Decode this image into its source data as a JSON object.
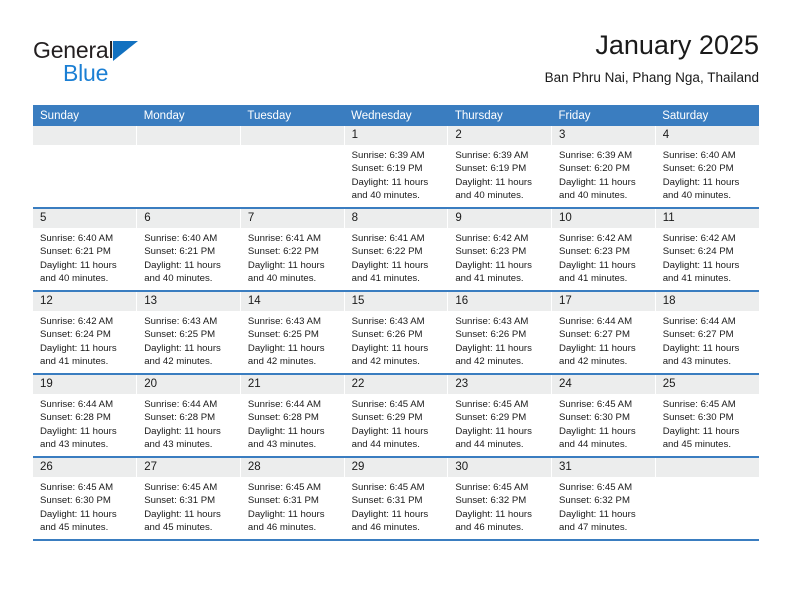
{
  "brand": {
    "name_part1": "General",
    "name_part2": "Blue",
    "triangle_icon": "triangle-icon",
    "accent_color": "#1b7fd4"
  },
  "header": {
    "title": "January 2025",
    "subtitle": "Ban Phru Nai, Phang Nga, Thailand"
  },
  "theme": {
    "header_row_bg": "#3a7dc0",
    "daynum_bg": "#eceded",
    "week_divider": "#3a7dc0"
  },
  "weekdays": [
    "Sunday",
    "Monday",
    "Tuesday",
    "Wednesday",
    "Thursday",
    "Friday",
    "Saturday"
  ],
  "weeks": [
    [
      {
        "day": "",
        "sunrise": "",
        "sunset": "",
        "daylight1": "",
        "daylight2": "",
        "empty": true
      },
      {
        "day": "",
        "sunrise": "",
        "sunset": "",
        "daylight1": "",
        "daylight2": "",
        "empty": true
      },
      {
        "day": "",
        "sunrise": "",
        "sunset": "",
        "daylight1": "",
        "daylight2": "",
        "empty": true
      },
      {
        "day": "1",
        "sunrise": "Sunrise: 6:39 AM",
        "sunset": "Sunset: 6:19 PM",
        "daylight1": "Daylight: 11 hours",
        "daylight2": "and 40 minutes.",
        "empty": false
      },
      {
        "day": "2",
        "sunrise": "Sunrise: 6:39 AM",
        "sunset": "Sunset: 6:19 PM",
        "daylight1": "Daylight: 11 hours",
        "daylight2": "and 40 minutes.",
        "empty": false
      },
      {
        "day": "3",
        "sunrise": "Sunrise: 6:39 AM",
        "sunset": "Sunset: 6:20 PM",
        "daylight1": "Daylight: 11 hours",
        "daylight2": "and 40 minutes.",
        "empty": false
      },
      {
        "day": "4",
        "sunrise": "Sunrise: 6:40 AM",
        "sunset": "Sunset: 6:20 PM",
        "daylight1": "Daylight: 11 hours",
        "daylight2": "and 40 minutes.",
        "empty": false
      }
    ],
    [
      {
        "day": "5",
        "sunrise": "Sunrise: 6:40 AM",
        "sunset": "Sunset: 6:21 PM",
        "daylight1": "Daylight: 11 hours",
        "daylight2": "and 40 minutes.",
        "empty": false
      },
      {
        "day": "6",
        "sunrise": "Sunrise: 6:40 AM",
        "sunset": "Sunset: 6:21 PM",
        "daylight1": "Daylight: 11 hours",
        "daylight2": "and 40 minutes.",
        "empty": false
      },
      {
        "day": "7",
        "sunrise": "Sunrise: 6:41 AM",
        "sunset": "Sunset: 6:22 PM",
        "daylight1": "Daylight: 11 hours",
        "daylight2": "and 40 minutes.",
        "empty": false
      },
      {
        "day": "8",
        "sunrise": "Sunrise: 6:41 AM",
        "sunset": "Sunset: 6:22 PM",
        "daylight1": "Daylight: 11 hours",
        "daylight2": "and 41 minutes.",
        "empty": false
      },
      {
        "day": "9",
        "sunrise": "Sunrise: 6:42 AM",
        "sunset": "Sunset: 6:23 PM",
        "daylight1": "Daylight: 11 hours",
        "daylight2": "and 41 minutes.",
        "empty": false
      },
      {
        "day": "10",
        "sunrise": "Sunrise: 6:42 AM",
        "sunset": "Sunset: 6:23 PM",
        "daylight1": "Daylight: 11 hours",
        "daylight2": "and 41 minutes.",
        "empty": false
      },
      {
        "day": "11",
        "sunrise": "Sunrise: 6:42 AM",
        "sunset": "Sunset: 6:24 PM",
        "daylight1": "Daylight: 11 hours",
        "daylight2": "and 41 minutes.",
        "empty": false
      }
    ],
    [
      {
        "day": "12",
        "sunrise": "Sunrise: 6:42 AM",
        "sunset": "Sunset: 6:24 PM",
        "daylight1": "Daylight: 11 hours",
        "daylight2": "and 41 minutes.",
        "empty": false
      },
      {
        "day": "13",
        "sunrise": "Sunrise: 6:43 AM",
        "sunset": "Sunset: 6:25 PM",
        "daylight1": "Daylight: 11 hours",
        "daylight2": "and 42 minutes.",
        "empty": false
      },
      {
        "day": "14",
        "sunrise": "Sunrise: 6:43 AM",
        "sunset": "Sunset: 6:25 PM",
        "daylight1": "Daylight: 11 hours",
        "daylight2": "and 42 minutes.",
        "empty": false
      },
      {
        "day": "15",
        "sunrise": "Sunrise: 6:43 AM",
        "sunset": "Sunset: 6:26 PM",
        "daylight1": "Daylight: 11 hours",
        "daylight2": "and 42 minutes.",
        "empty": false
      },
      {
        "day": "16",
        "sunrise": "Sunrise: 6:43 AM",
        "sunset": "Sunset: 6:26 PM",
        "daylight1": "Daylight: 11 hours",
        "daylight2": "and 42 minutes.",
        "empty": false
      },
      {
        "day": "17",
        "sunrise": "Sunrise: 6:44 AM",
        "sunset": "Sunset: 6:27 PM",
        "daylight1": "Daylight: 11 hours",
        "daylight2": "and 42 minutes.",
        "empty": false
      },
      {
        "day": "18",
        "sunrise": "Sunrise: 6:44 AM",
        "sunset": "Sunset: 6:27 PM",
        "daylight1": "Daylight: 11 hours",
        "daylight2": "and 43 minutes.",
        "empty": false
      }
    ],
    [
      {
        "day": "19",
        "sunrise": "Sunrise: 6:44 AM",
        "sunset": "Sunset: 6:28 PM",
        "daylight1": "Daylight: 11 hours",
        "daylight2": "and 43 minutes.",
        "empty": false
      },
      {
        "day": "20",
        "sunrise": "Sunrise: 6:44 AM",
        "sunset": "Sunset: 6:28 PM",
        "daylight1": "Daylight: 11 hours",
        "daylight2": "and 43 minutes.",
        "empty": false
      },
      {
        "day": "21",
        "sunrise": "Sunrise: 6:44 AM",
        "sunset": "Sunset: 6:28 PM",
        "daylight1": "Daylight: 11 hours",
        "daylight2": "and 43 minutes.",
        "empty": false
      },
      {
        "day": "22",
        "sunrise": "Sunrise: 6:45 AM",
        "sunset": "Sunset: 6:29 PM",
        "daylight1": "Daylight: 11 hours",
        "daylight2": "and 44 minutes.",
        "empty": false
      },
      {
        "day": "23",
        "sunrise": "Sunrise: 6:45 AM",
        "sunset": "Sunset: 6:29 PM",
        "daylight1": "Daylight: 11 hours",
        "daylight2": "and 44 minutes.",
        "empty": false
      },
      {
        "day": "24",
        "sunrise": "Sunrise: 6:45 AM",
        "sunset": "Sunset: 6:30 PM",
        "daylight1": "Daylight: 11 hours",
        "daylight2": "and 44 minutes.",
        "empty": false
      },
      {
        "day": "25",
        "sunrise": "Sunrise: 6:45 AM",
        "sunset": "Sunset: 6:30 PM",
        "daylight1": "Daylight: 11 hours",
        "daylight2": "and 45 minutes.",
        "empty": false
      }
    ],
    [
      {
        "day": "26",
        "sunrise": "Sunrise: 6:45 AM",
        "sunset": "Sunset: 6:30 PM",
        "daylight1": "Daylight: 11 hours",
        "daylight2": "and 45 minutes.",
        "empty": false
      },
      {
        "day": "27",
        "sunrise": "Sunrise: 6:45 AM",
        "sunset": "Sunset: 6:31 PM",
        "daylight1": "Daylight: 11 hours",
        "daylight2": "and 45 minutes.",
        "empty": false
      },
      {
        "day": "28",
        "sunrise": "Sunrise: 6:45 AM",
        "sunset": "Sunset: 6:31 PM",
        "daylight1": "Daylight: 11 hours",
        "daylight2": "and 46 minutes.",
        "empty": false
      },
      {
        "day": "29",
        "sunrise": "Sunrise: 6:45 AM",
        "sunset": "Sunset: 6:31 PM",
        "daylight1": "Daylight: 11 hours",
        "daylight2": "and 46 minutes.",
        "empty": false
      },
      {
        "day": "30",
        "sunrise": "Sunrise: 6:45 AM",
        "sunset": "Sunset: 6:32 PM",
        "daylight1": "Daylight: 11 hours",
        "daylight2": "and 46 minutes.",
        "empty": false
      },
      {
        "day": "31",
        "sunrise": "Sunrise: 6:45 AM",
        "sunset": "Sunset: 6:32 PM",
        "daylight1": "Daylight: 11 hours",
        "daylight2": "and 47 minutes.",
        "empty": false
      },
      {
        "day": "",
        "sunrise": "",
        "sunset": "",
        "daylight1": "",
        "daylight2": "",
        "empty": true
      }
    ]
  ]
}
